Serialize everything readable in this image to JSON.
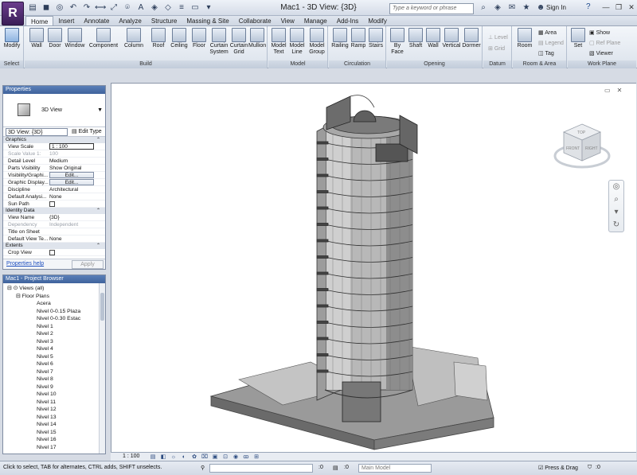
{
  "app": {
    "logo_letter": "R",
    "window_title": "Mac1 - 3D View: {3D}"
  },
  "search": {
    "placeholder": "Type a keyword or phrase"
  },
  "user": {
    "signin_label": "Sign In",
    "help_label": "?"
  },
  "tabs": [
    {
      "label": "Home",
      "active": true
    },
    {
      "label": "Insert"
    },
    {
      "label": "Annotate"
    },
    {
      "label": "Analyze"
    },
    {
      "label": "Structure"
    },
    {
      "label": "Massing & Site"
    },
    {
      "label": "Collaborate"
    },
    {
      "label": "View"
    },
    {
      "label": "Manage"
    },
    {
      "label": "Add-Ins"
    },
    {
      "label": "Modify"
    }
  ],
  "ribbon": {
    "select": {
      "title": "Select",
      "modify": "Modify"
    },
    "build": {
      "title": "Build",
      "wall": "Wall",
      "door": "Door",
      "window": "Window",
      "component": "Component",
      "column": "Column",
      "roof": "Roof",
      "ceiling": "Ceiling",
      "floor": "Floor",
      "curtain_system_1": "Curtain",
      "curtain_system_2": "System",
      "curtain_grid_1": "Curtain",
      "curtain_grid_2": "Grid",
      "mullion": "Mullion"
    },
    "model": {
      "title": "Model",
      "text_1": "Model",
      "text_2": "Text",
      "line_1": "Model",
      "line_2": "Line",
      "group_1": "Model",
      "group_2": "Group"
    },
    "circulation": {
      "title": "Circulation",
      "railing": "Railing",
      "ramp": "Ramp",
      "stairs": "Stairs"
    },
    "opening": {
      "title": "Opening",
      "by_face_1": "By",
      "by_face_2": "Face",
      "shaft": "Shaft",
      "wall": "Wall",
      "vertical": "Vertical",
      "dormer": "Dormer"
    },
    "datum": {
      "title": "Datum",
      "level": "Level",
      "grid": "Grid"
    },
    "room_area": {
      "title": "Room & Area",
      "room": "Room",
      "area": "Area",
      "legend": "Legend",
      "tag": "Tag"
    },
    "work_plane": {
      "title": "Work Plane",
      "set": "Set",
      "show": "Show",
      "ref_plane": "Ref Plane",
      "viewer": "Viewer"
    }
  },
  "properties": {
    "title": "Properties",
    "type_name": "3D View",
    "view_selector": "3D View: {3D}",
    "edit_type": "Edit Type",
    "groups": {
      "graphics": "Graphics",
      "identity": "Identity Data",
      "extents": "Extents"
    },
    "rows": {
      "view_scale": {
        "k": "View Scale",
        "v": "1 : 100"
      },
      "scale_value": {
        "k": "Scale Value  1:",
        "v": "100"
      },
      "detail_level": {
        "k": "Detail Level",
        "v": "Medium"
      },
      "parts_visibility": {
        "k": "Parts Visibility",
        "v": "Show Original"
      },
      "visibility": {
        "k": "Visibility/Graphi...",
        "v": "Edit..."
      },
      "graphic_display": {
        "k": "Graphic Display...",
        "v": "Edit..."
      },
      "discipline": {
        "k": "Discipline",
        "v": "Architectural"
      },
      "default_analysis": {
        "k": "Default Analysi...",
        "v": "None"
      },
      "sun_path": {
        "k": "Sun Path",
        "v": ""
      },
      "view_name": {
        "k": "View Name",
        "v": "{3D}"
      },
      "dependency": {
        "k": "Dependency",
        "v": "Independent"
      },
      "title_on_sheet": {
        "k": "Title on Sheet",
        "v": ""
      },
      "default_view_template": {
        "k": "Default View Te...",
        "v": "None"
      },
      "crop_view": {
        "k": "Crop View",
        "v": ""
      }
    },
    "help_link": "Properties help",
    "apply_label": "Apply"
  },
  "browser": {
    "title": "Mac1 - Project Browser",
    "root": "Views (all)",
    "floor_plans": "Floor Plans",
    "items": [
      "Acera",
      "Nivel 0-0.15 Plaza",
      "Nivel 0-0.30 Estac",
      "Nivel 1",
      "Nivel 2",
      "Nivel 3",
      "Nivel 4",
      "Nivel 5",
      "Nivel 6",
      "Nivel 7",
      "Nivel 8",
      "Nivel 9",
      "Nivel 10",
      "Nivel 11",
      "Nivel 12",
      "Nivel 13",
      "Nivel 14",
      "Nivel 15",
      "Nivel 16",
      "Nivel 17"
    ]
  },
  "viewcube": {
    "top": "TOP",
    "front": "FRONT",
    "right": "RIGHT"
  },
  "view_control": {
    "scale": "1 : 100"
  },
  "status": {
    "hint": "Click to select, TAB for alternates, CTRL adds, SHIFT unselects.",
    "count_1": ":0",
    "count_2": ":0",
    "model_selector": "Main Model",
    "press_drag": "Press & Drag",
    "filter_count": ":0"
  }
}
